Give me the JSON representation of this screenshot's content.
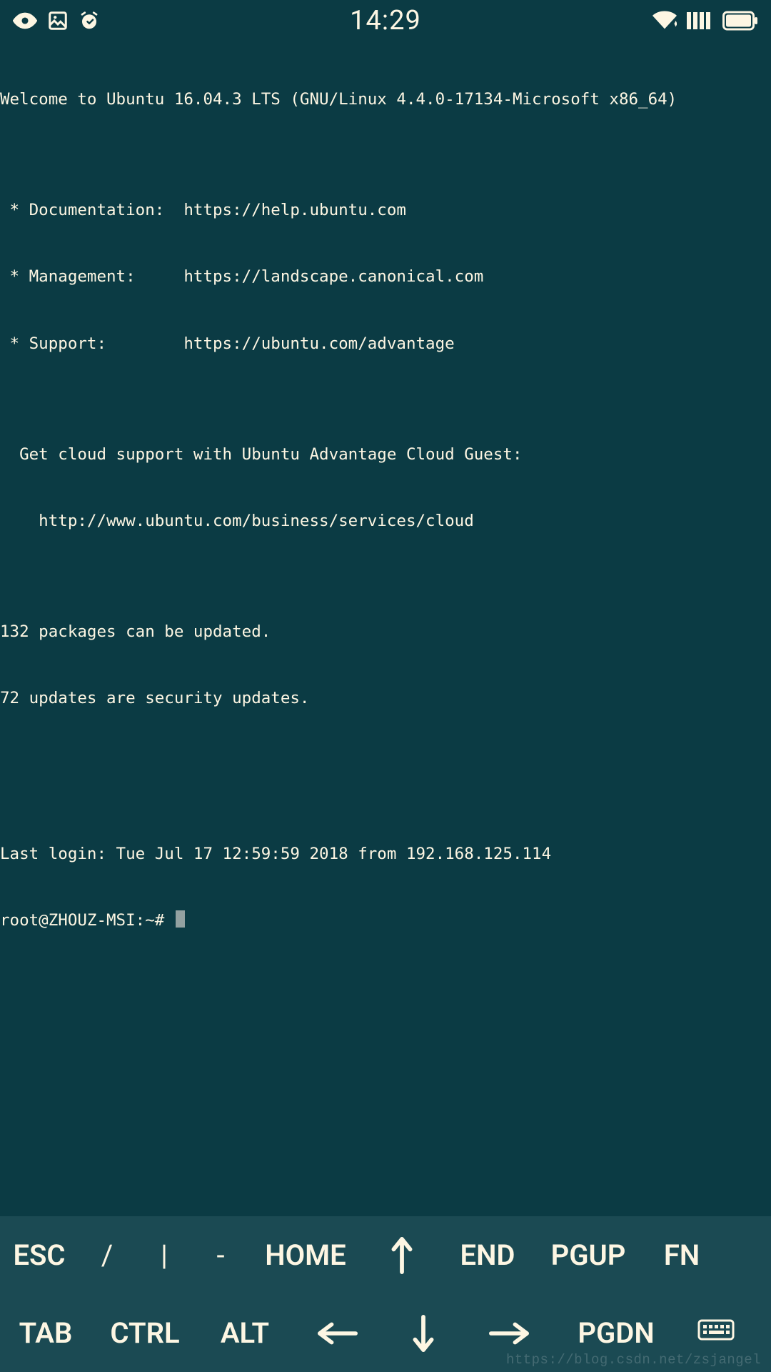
{
  "status_bar": {
    "time": "14:29"
  },
  "terminal": {
    "lines": [
      "Welcome to Ubuntu 16.04.3 LTS (GNU/Linux 4.4.0-17134-Microsoft x86_64)",
      "",
      " * Documentation:  https://help.ubuntu.com",
      " * Management:     https://landscape.canonical.com",
      " * Support:        https://ubuntu.com/advantage",
      "",
      "  Get cloud support with Ubuntu Advantage Cloud Guest:",
      "    http://www.ubuntu.com/business/services/cloud",
      "",
      "132 packages can be updated.",
      "72 updates are security updates.",
      "",
      "",
      "Last login: Tue Jul 17 12:59:59 2018 from 192.168.125.114"
    ],
    "prompt": "root@ZHOUZ-MSI:~# "
  },
  "keys": {
    "row0": [
      "ESC",
      "/",
      "|",
      "-",
      "HOME",
      "↑",
      "END",
      "PGUP",
      "FN"
    ],
    "row1": [
      "TAB",
      "CTRL",
      "ALT",
      "←",
      "↓",
      "→",
      "PGDN",
      "⌨"
    ]
  },
  "watermark": "https://blog.csdn.net/zsjangel"
}
